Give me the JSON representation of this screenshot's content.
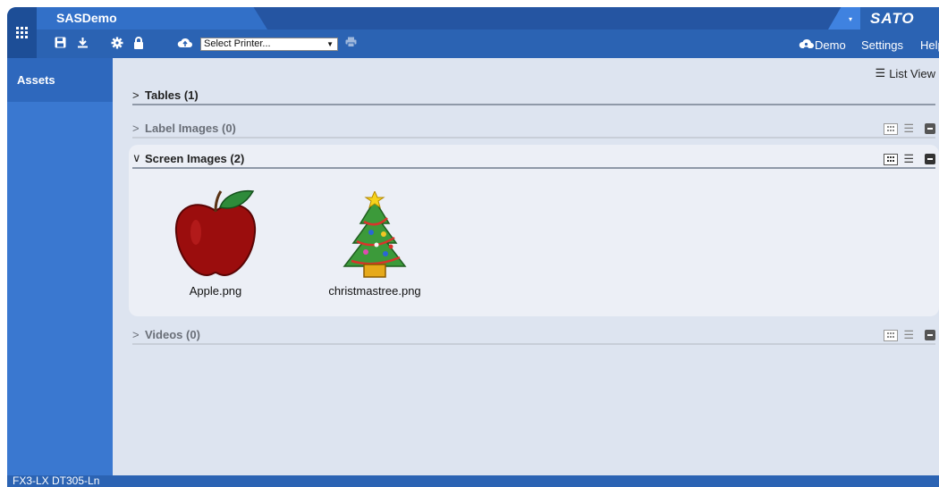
{
  "app": {
    "title": "SASDemo",
    "brand": "SATO"
  },
  "toolbar": {
    "printer_select": "Select Printer...",
    "user_label": "Demo",
    "settings_label": "Settings",
    "help_label": "Help"
  },
  "sidebar": {
    "items": [
      {
        "label": "Assets"
      }
    ]
  },
  "main": {
    "list_view_label": "List View",
    "sections": [
      {
        "name": "Tables",
        "count": "(1)"
      },
      {
        "name": "Label Images",
        "count": "(0)"
      },
      {
        "name": "Screen Images",
        "count": "(2)"
      },
      {
        "name": "Videos",
        "count": "(0)"
      }
    ],
    "screen_images": [
      {
        "filename": "Apple.png",
        "icon": "apple-image"
      },
      {
        "filename": "christmastree.png",
        "icon": "christmas-tree-image"
      }
    ]
  },
  "statusbar": {
    "text": "FX3-LX DT305-Ln"
  },
  "colors": {
    "primary": "#2b63b3",
    "sidebar": "#3a78d0",
    "main_bg": "#dde4f0"
  }
}
